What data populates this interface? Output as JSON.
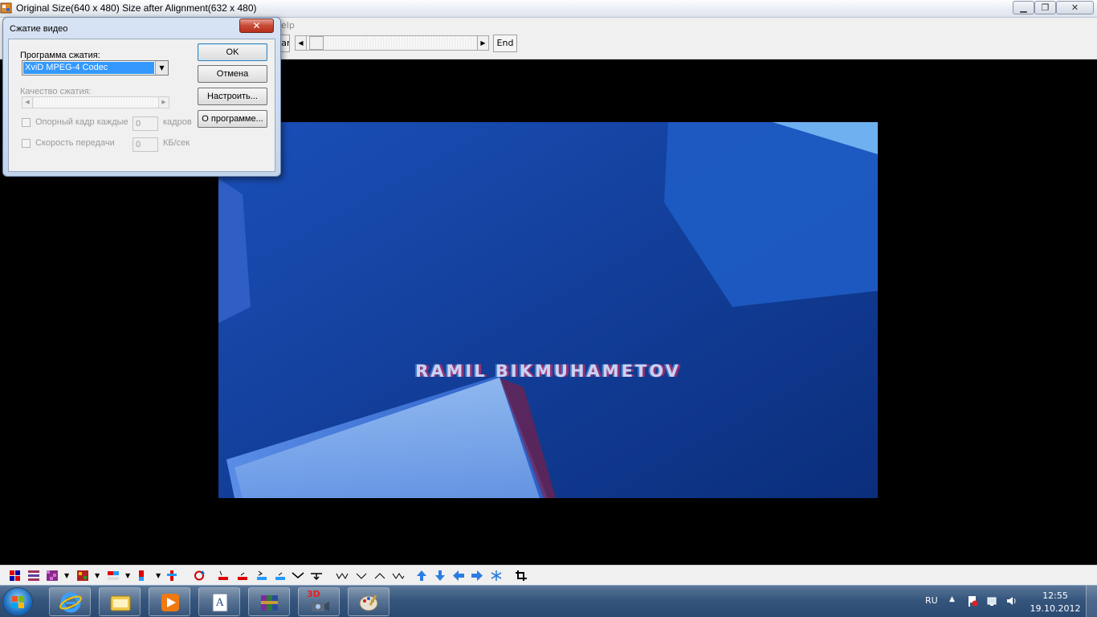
{
  "window": {
    "title": "Original Size(640 x 480)  Size after Alignment(632 x 480)",
    "menu_help": "elp",
    "minimize": "▁",
    "maximize": "❐",
    "close": "✕"
  },
  "top_toolbar": {
    "start_label": "Start",
    "end_label": "End",
    "seek_left": "◀",
    "seek_right": "▶"
  },
  "video": {
    "caption": "RAMIL BIKMUHAMETOV"
  },
  "dialog": {
    "title": "Сжатие видео",
    "close_glyph": "✕",
    "codec_label": "Программа сжатия:",
    "codec_value": "XviD MPEG-4 Codec",
    "codec_arrow": "▼",
    "quality_label": "Качество сжатия:",
    "quality_left": "◀",
    "quality_right": "▶",
    "keyframe_label": "Опорный кадр каждые",
    "keyframe_value": "0",
    "keyframe_unit": "кадров",
    "datarate_label": "Скорость передачи",
    "datarate_value": "0",
    "datarate_unit": "КБ/сек",
    "ok_label": "OK",
    "cancel_label": "Отмена",
    "configure_label": "Настроить...",
    "about_label": "О программе..."
  },
  "taskbar": {
    "language": "RU",
    "tray_arrow": "▲",
    "time": "12:55",
    "date": "19.10.2012",
    "app_3d_label": "3D"
  },
  "colors": {
    "video_bg": "#0a2f80",
    "selection": "#3399ff",
    "dialog_close": "#c74a35"
  }
}
